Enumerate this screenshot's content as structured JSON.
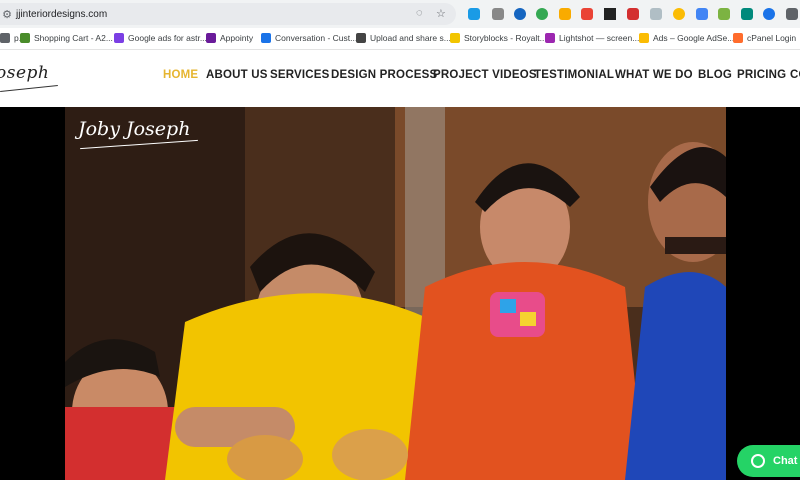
{
  "browser": {
    "url": "jjinteriordesigns.com",
    "bookmarks": [
      {
        "label": "p...",
        "color": "#5f6368"
      },
      {
        "label": "Shopping Cart - A2...",
        "color": "#4a8c2a"
      },
      {
        "label": "Google ads for astr...",
        "color": "#7b3fe4"
      },
      {
        "label": "Appointy",
        "color": "#6a1b9a"
      },
      {
        "label": "Conversation - Cust...",
        "color": "#1a73e8"
      },
      {
        "label": "Upload and share s...",
        "color": "#444444"
      },
      {
        "label": "Storyblocks - Royalt...",
        "color": "#f2c500"
      },
      {
        "label": "Lightshot — screen...",
        "color": "#9c27b0"
      },
      {
        "label": "Ads – Google AdSe...",
        "color": "#fbbc04"
      },
      {
        "label": "cPanel Login",
        "color": "#ff6c2c"
      }
    ]
  },
  "site": {
    "logo": "oseph",
    "nav": [
      {
        "label": "HOME",
        "active": true
      },
      {
        "label": "ABOUT US"
      },
      {
        "label": "SERVICES"
      },
      {
        "label": "DESIGN PROCESS"
      },
      {
        "label": "PROJECT VIDEOS"
      },
      {
        "label": "TESTIMONIAL"
      },
      {
        "label": "WHAT WE DO"
      },
      {
        "label": "BLOG"
      },
      {
        "label": "PRICING"
      },
      {
        "label": "CO"
      }
    ],
    "active_color": "#e6b530"
  },
  "hero": {
    "signature": "Joby Joseph"
  },
  "chat_widget": {
    "label": "Chat",
    "color": "#25d366"
  }
}
